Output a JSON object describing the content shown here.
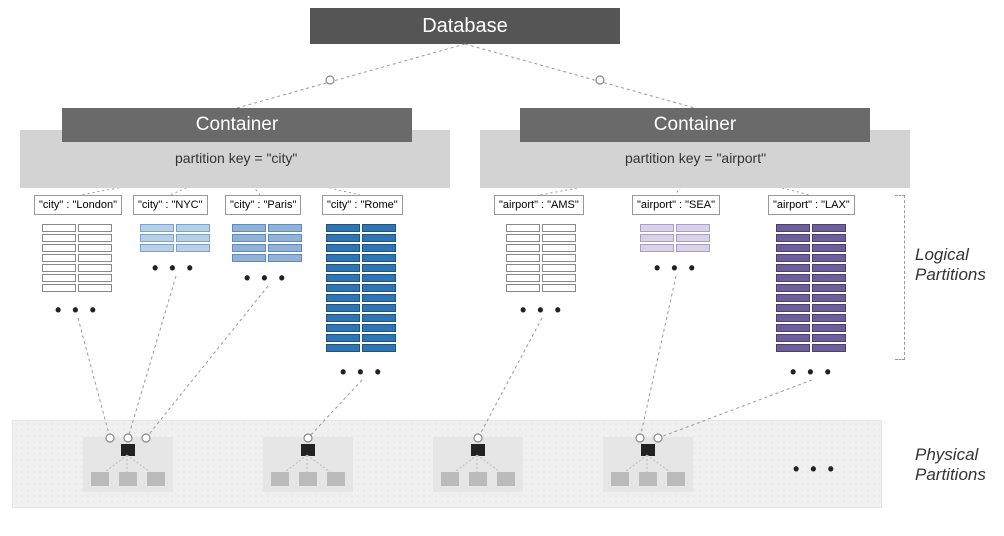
{
  "database": {
    "label": "Database"
  },
  "containers": [
    {
      "label": "Container",
      "partition_key_label": "partition key = \"city\"",
      "partitions": [
        {
          "key_text": "\"city\" : \"London\"",
          "rows": 7,
          "color": "white"
        },
        {
          "key_text": "\"city\" : \"NYC\"",
          "rows": 3,
          "color": "blue-light"
        },
        {
          "key_text": "\"city\" : \"Paris\"",
          "rows": 4,
          "color": "blue-mid"
        },
        {
          "key_text": "\"city\" : \"Rome\"",
          "rows": 13,
          "color": "blue-dark"
        }
      ]
    },
    {
      "label": "Container",
      "partition_key_label": "partition key = \"airport\"",
      "partitions": [
        {
          "key_text": "\"airport\" : \"AMS\"",
          "rows": 7,
          "color": "white"
        },
        {
          "key_text": "\"airport\" : \"SEA\"",
          "rows": 3,
          "color": "purple-light"
        },
        {
          "key_text": "\"airport\" : \"LAX\"",
          "rows": 13,
          "color": "purple-dark"
        }
      ]
    }
  ],
  "side_labels": {
    "logical": "Logical Partitions",
    "physical": "Physical Partitions"
  },
  "ellipsis": "• • •",
  "physical_nodes_count": 4
}
